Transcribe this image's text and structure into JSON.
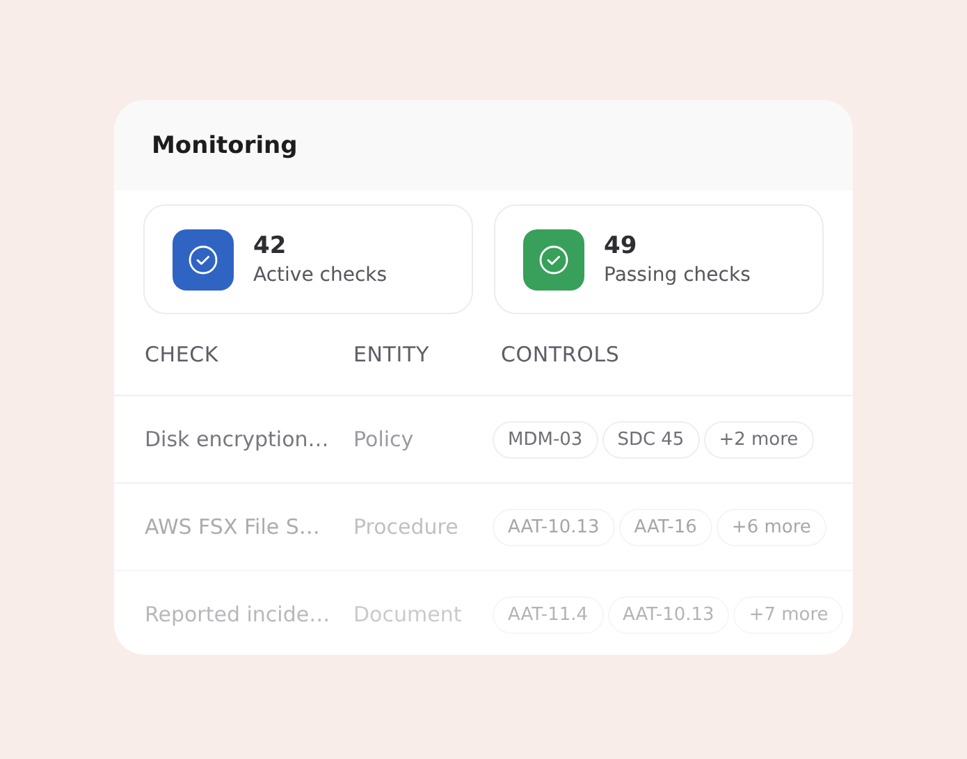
{
  "title": "Monitoring",
  "stats": [
    {
      "value": "42",
      "label": "Active checks",
      "color": "#2f64c3"
    },
    {
      "value": "49",
      "label": "Passing checks",
      "color": "#38a05a"
    }
  ],
  "table": {
    "columns": [
      "CHECK",
      "ENTITY",
      "CONTROLS"
    ],
    "rows": [
      {
        "check": "Disk encryption…",
        "entity": "Policy",
        "controls": [
          "MDM-03",
          "SDC 45",
          "+2 more"
        ]
      },
      {
        "check": "AWS FSX File S…",
        "entity": "Procedure",
        "controls": [
          "AAT-10.13",
          "AAT-16",
          "+6 more"
        ]
      },
      {
        "check": "Reported incide…",
        "entity": "Document",
        "controls": [
          "AAT-11.4",
          "AAT-10.13",
          "+7 more"
        ]
      }
    ]
  }
}
